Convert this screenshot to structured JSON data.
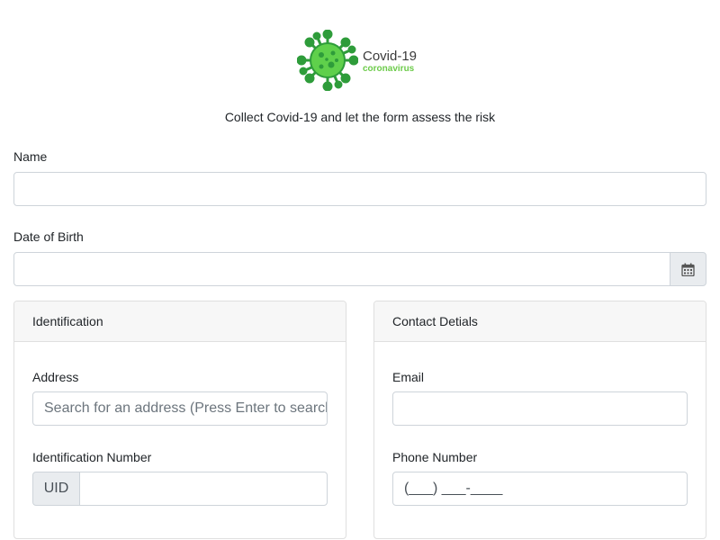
{
  "logo": {
    "title": "Covid-19",
    "subtitle": "coronavirus",
    "icon": "virus-icon",
    "colors": {
      "virus_dark": "#2e9c3a",
      "virus_light": "#5fd04b",
      "subtitle": "#6ccb4a"
    }
  },
  "form": {
    "subtitle": "Collect Covid-19 and let the form assess the risk",
    "name": {
      "label": "Name",
      "value": ""
    },
    "dob": {
      "label": "Date of Birth",
      "value": "",
      "icon": "calendar-icon"
    }
  },
  "identification": {
    "header": "Identification",
    "address": {
      "label": "Address",
      "placeholder": "Search for an address (Press Enter to search)"
    },
    "id_number": {
      "label": "Identification Number",
      "prefix": "UID",
      "value": ""
    }
  },
  "contact": {
    "header": "Contact Detials",
    "email": {
      "label": "Email",
      "value": ""
    },
    "phone": {
      "label": "Phone Number",
      "mask": "(___) ___-____"
    }
  }
}
